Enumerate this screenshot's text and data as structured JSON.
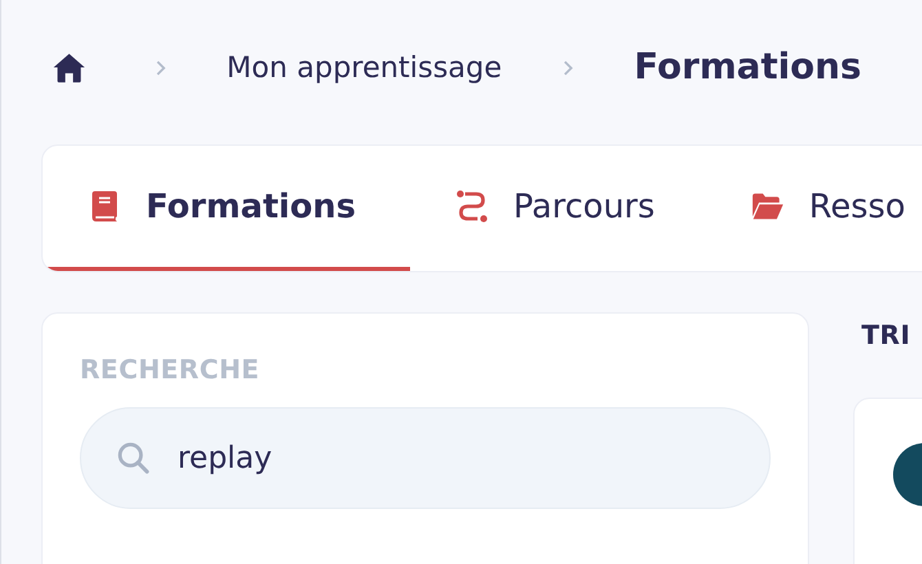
{
  "breadcrumb": {
    "items": [
      {
        "kind": "home"
      },
      {
        "kind": "link",
        "label": "Mon apprentissage"
      },
      {
        "kind": "current",
        "label": "Formations"
      }
    ]
  },
  "tabs": [
    {
      "label": "Formations",
      "kind": "book",
      "selected": true
    },
    {
      "label": "Parcours",
      "kind": "route",
      "selected": false
    },
    {
      "label": "Resso",
      "kind": "folder",
      "selected": false
    }
  ],
  "search_panel": {
    "heading": "RECHERCHE",
    "search": {
      "value": "replay"
    }
  },
  "results": {
    "heading": "TRI"
  }
}
